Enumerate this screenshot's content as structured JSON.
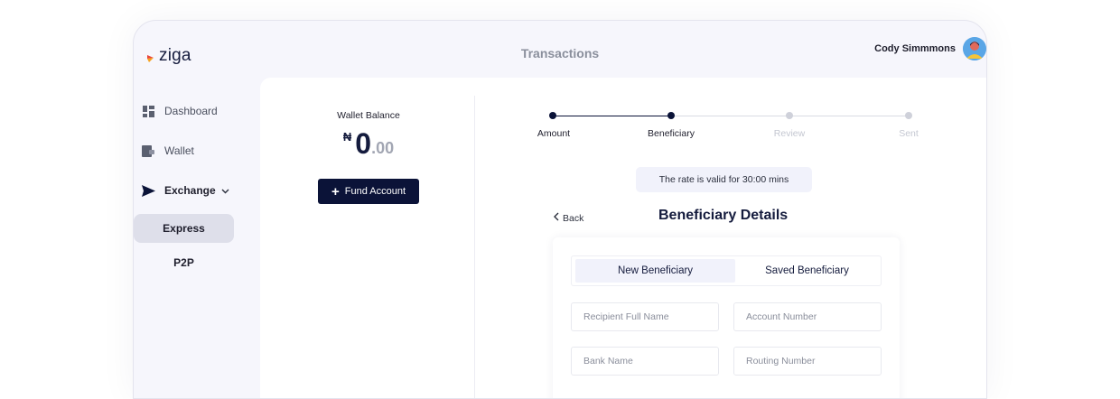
{
  "brand": {
    "name": "ziga"
  },
  "header": {
    "title": "Transactions",
    "user_name": "Cody Simmmons"
  },
  "sidebar": {
    "items": [
      {
        "label": "Dashboard",
        "icon": "dashboard-grid-icon"
      },
      {
        "label": "Wallet",
        "icon": "wallet-icon"
      },
      {
        "label": "Exchange",
        "icon": "send-arrow-icon",
        "expanded": true
      }
    ],
    "sub_items": [
      {
        "label": "Express",
        "active": true
      },
      {
        "label": "P2P",
        "active": false
      }
    ]
  },
  "wallet": {
    "label": "Wallet Balance",
    "currency": "₦",
    "whole": "0",
    "decimal": ".00",
    "fund_button": "Fund Account"
  },
  "stepper": {
    "steps": [
      {
        "label": "Amount",
        "state": "done"
      },
      {
        "label": "Beneficiary",
        "state": "current"
      },
      {
        "label": "Review",
        "state": "pending"
      },
      {
        "label": "Sent",
        "state": "pending"
      }
    ]
  },
  "rate_notice": "The rate is valid for 30:00 mins",
  "beneficiary": {
    "back_label": "Back",
    "title": "Beneficiary Details",
    "tabs": [
      {
        "label": "New Beneficiary",
        "active": true
      },
      {
        "label": "Saved Beneficiary",
        "active": false
      }
    ],
    "fields": {
      "full_name": "Recipient Full Name",
      "account_number": "Account Number",
      "bank_name": "Bank Name",
      "routing_number": "Routing Number"
    }
  },
  "colors": {
    "primary": "#0b1338",
    "sidebar_bg": "#f6f6fc",
    "active_item": "#dedfea",
    "muted": "#c4c7d1"
  }
}
